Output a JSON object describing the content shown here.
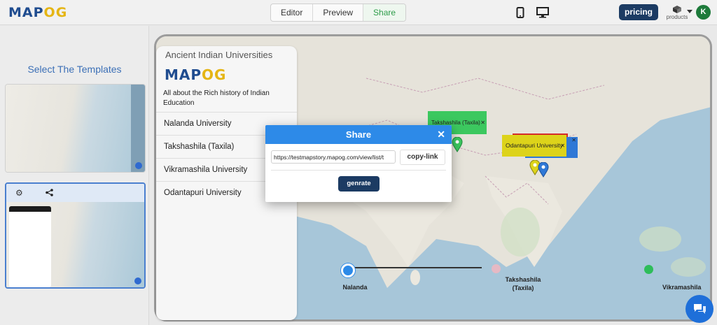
{
  "header": {
    "logo_main": "MAP",
    "logo_accent": "OG",
    "tabs": [
      {
        "label": "Editor"
      },
      {
        "label": "Preview"
      },
      {
        "label": "Share"
      }
    ],
    "pricing_label": "pricing",
    "products_label": "products",
    "avatar_initial": "K"
  },
  "sidebar": {
    "title": "Select The Templates"
  },
  "story": {
    "title": "Ancient Indian Universities",
    "logo_main": "MAP",
    "logo_accent": "OG",
    "description": "All about the Rich history of Indian Education",
    "items": [
      {
        "label": "Nalanda University"
      },
      {
        "label": "Takshashila (Taxila)"
      },
      {
        "label": "Vikramashila University"
      },
      {
        "label": "Odantapuri University"
      }
    ]
  },
  "map": {
    "popups": [
      {
        "label": "Takshashila (Taxila)",
        "color": "#3cc85f"
      },
      {
        "label": "Odantapuri University",
        "color": "#ddd31a"
      }
    ],
    "timeline_labels": [
      {
        "label": "Nalanda"
      },
      {
        "label": "Takshashila (Taxila)"
      },
      {
        "label": "Vikramashila"
      }
    ]
  },
  "modal": {
    "title": "Share",
    "link_value": "https://testmapstory.mapog.com/view/list/t",
    "copy_label": "copy-link",
    "generate_label": "genrate"
  },
  "colors": {
    "brand": "#1c3b63",
    "modal_header": "#2d8ae8",
    "share_active": "#2e9d4a"
  }
}
